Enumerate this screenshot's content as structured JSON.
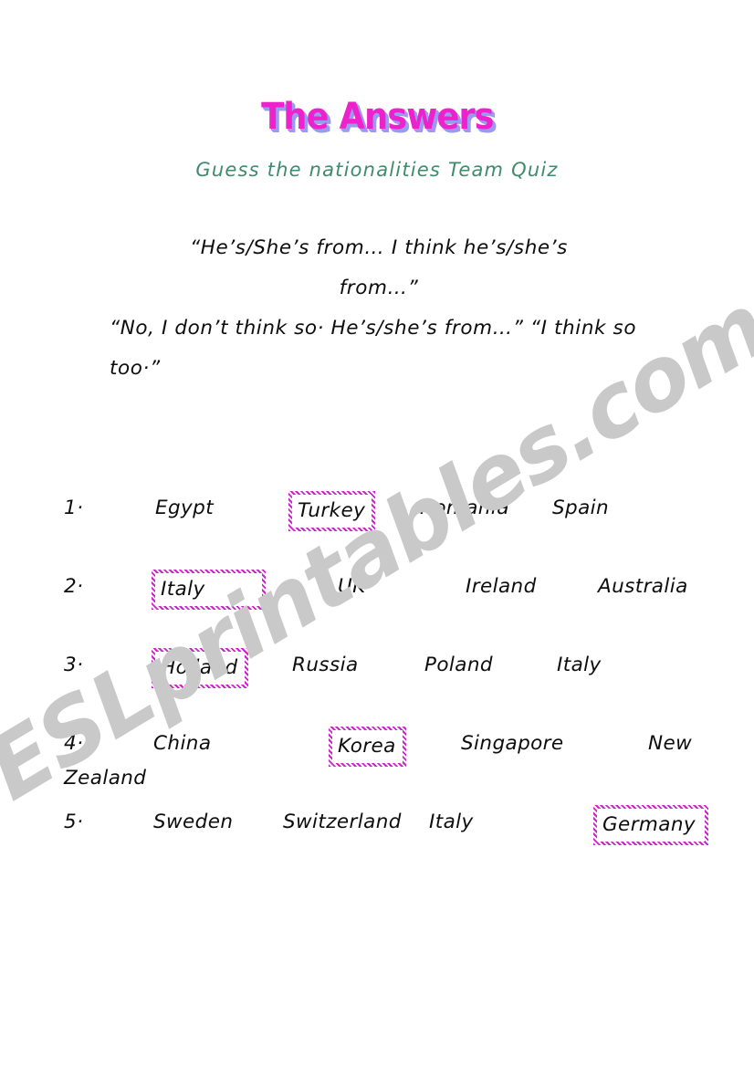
{
  "document": {
    "title": "The Answers",
    "subtitle": "Guess the nationalities Team Quiz",
    "watermark": "ESLprintables.com",
    "colors": {
      "title_fill": "#ee22cc",
      "title_shadow": "#9a9aee",
      "subtitle": "#3e8b6e",
      "answer_box_border": "#cc22cc",
      "body_text": "#0d0d0d",
      "watermark": "#c9c9c9",
      "page_background": "#ffffff"
    }
  },
  "quote": {
    "line1": "“He’s/She’s from… I think he’s/she’s",
    "line2": "from…”",
    "line3": "“No, I don’t think so· He’s/she’s from…” “I think so too·”"
  },
  "answers": [
    {
      "number": "1·",
      "options": [
        {
          "label": "Egypt",
          "correct": false
        },
        {
          "label": "Turkey",
          "correct": true
        },
        {
          "label": "Romania",
          "correct": false
        },
        {
          "label": "Spain",
          "correct": false
        }
      ]
    },
    {
      "number": "2·",
      "options": [
        {
          "label": "Italy",
          "correct": true
        },
        {
          "label": "UK",
          "correct": false
        },
        {
          "label": "Ireland",
          "correct": false
        },
        {
          "label": "Australia",
          "correct": false
        }
      ]
    },
    {
      "number": "3·",
      "options": [
        {
          "label": "Holland",
          "correct": true
        },
        {
          "label": "Russia",
          "correct": false
        },
        {
          "label": "Poland",
          "correct": false
        },
        {
          "label": "Italy",
          "correct": false
        }
      ]
    },
    {
      "number": "4·",
      "options": [
        {
          "label": "China",
          "correct": false
        },
        {
          "label": "Korea",
          "correct": true
        },
        {
          "label": "Singapore",
          "correct": false
        },
        {
          "label": "New",
          "correct": false
        }
      ],
      "wrapped": "Zealand"
    },
    {
      "number": "5·",
      "options": [
        {
          "label": "Sweden",
          "correct": false
        },
        {
          "label": "Switzerland",
          "correct": false
        },
        {
          "label": "Italy",
          "correct": false
        },
        {
          "label": "Germany",
          "correct": true
        }
      ]
    }
  ]
}
